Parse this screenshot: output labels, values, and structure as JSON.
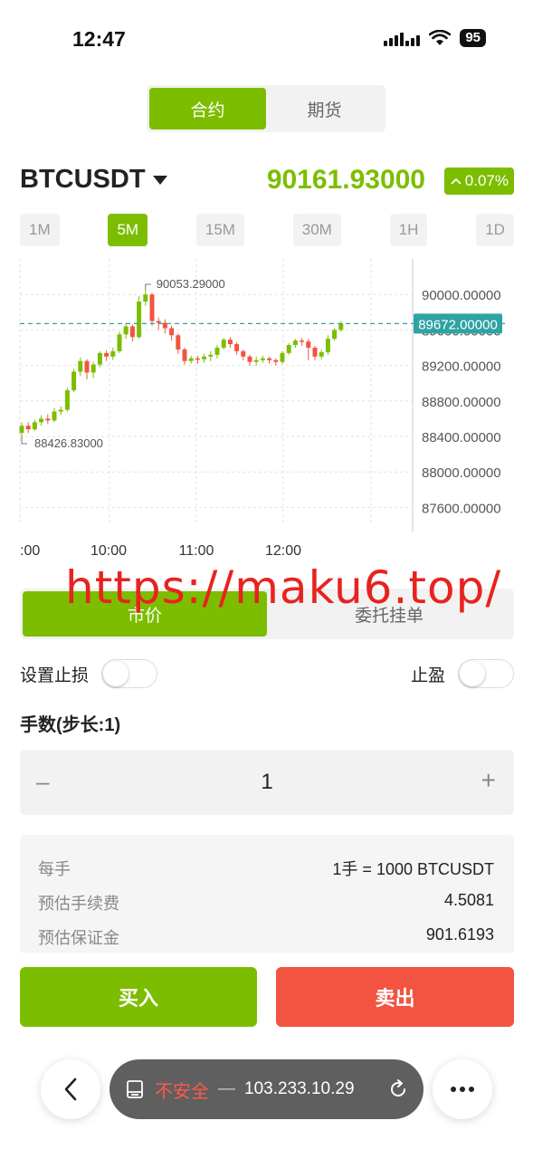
{
  "status_bar": {
    "time": "12:47",
    "battery": "95"
  },
  "top_tabs": [
    {
      "label": "合约",
      "active": true
    },
    {
      "label": "期货",
      "active": false
    }
  ],
  "symbol": {
    "name": "BTCUSDT",
    "price": "90161.93000",
    "change": "0.07%"
  },
  "intervals": [
    {
      "label": "1M",
      "active": false
    },
    {
      "label": "5M",
      "active": true
    },
    {
      "label": "15M",
      "active": false
    },
    {
      "label": "30M",
      "active": false
    },
    {
      "label": "1H",
      "active": false
    },
    {
      "label": "1D",
      "active": false
    }
  ],
  "chart_data": {
    "type": "candlestick",
    "y_ticks": [
      "90000.00000",
      "89600.00000",
      "89200.00000",
      "88800.00000",
      "88400.00000",
      "88000.00000",
      "87600.00000"
    ],
    "y_tick_values": [
      90000,
      89600,
      89200,
      88800,
      88400,
      88000,
      87600
    ],
    "ylim": [
      87400,
      90400
    ],
    "x_ticks": [
      ":00",
      "10:00",
      "11:00",
      "12:00"
    ],
    "current_price_label": "89672.00000",
    "current_price": 89672,
    "high_label": "90053.29000",
    "low_label": "88426.83000",
    "colors": {
      "up": "#7dbd00",
      "down": "#f25441",
      "current": "#2ea3a3"
    },
    "candles": [
      [
        88440,
        88520,
        88400,
        88560
      ],
      [
        88520,
        88480,
        88440,
        88560
      ],
      [
        88480,
        88560,
        88460,
        88590
      ],
      [
        88560,
        88600,
        88520,
        88640
      ],
      [
        88600,
        88580,
        88540,
        88650
      ],
      [
        88580,
        88680,
        88560,
        88720
      ],
      [
        88680,
        88700,
        88640,
        88740
      ],
      [
        88700,
        88920,
        88680,
        88950
      ],
      [
        88920,
        89130,
        88900,
        89160
      ],
      [
        89130,
        89250,
        89080,
        89290
      ],
      [
        89250,
        89120,
        89040,
        89270
      ],
      [
        89120,
        89210,
        89060,
        89240
      ],
      [
        89210,
        89340,
        89180,
        89360
      ],
      [
        89340,
        89300,
        89250,
        89370
      ],
      [
        89300,
        89360,
        89260,
        89400
      ],
      [
        89360,
        89550,
        89340,
        89580
      ],
      [
        89550,
        89640,
        89500,
        89680
      ],
      [
        89640,
        89520,
        89470,
        89660
      ],
      [
        89520,
        89920,
        89500,
        89980
      ],
      [
        89920,
        90000,
        89870,
        90053
      ],
      [
        90000,
        89700,
        89650,
        90020
      ],
      [
        89700,
        89680,
        89600,
        89740
      ],
      [
        89680,
        89620,
        89560,
        89720
      ],
      [
        89620,
        89540,
        89480,
        89650
      ],
      [
        89540,
        89380,
        89330,
        89560
      ],
      [
        89380,
        89250,
        89210,
        89400
      ],
      [
        89250,
        89280,
        89220,
        89310
      ],
      [
        89280,
        89270,
        89220,
        89310
      ],
      [
        89270,
        89300,
        89230,
        89330
      ],
      [
        89300,
        89320,
        89250,
        89360
      ],
      [
        89320,
        89400,
        89280,
        89430
      ],
      [
        89400,
        89490,
        89380,
        89510
      ],
      [
        89490,
        89440,
        89400,
        89520
      ],
      [
        89440,
        89360,
        89320,
        89460
      ],
      [
        89360,
        89300,
        89260,
        89380
      ],
      [
        89300,
        89240,
        89200,
        89320
      ],
      [
        89240,
        89260,
        89200,
        89300
      ],
      [
        89260,
        89280,
        89230,
        89310
      ],
      [
        89280,
        89260,
        89220,
        89300
      ],
      [
        89260,
        89240,
        89200,
        89280
      ],
      [
        89240,
        89340,
        89220,
        89360
      ],
      [
        89340,
        89430,
        89320,
        89450
      ],
      [
        89430,
        89480,
        89400,
        89500
      ],
      [
        89480,
        89470,
        89420,
        89510
      ],
      [
        89470,
        89400,
        89260,
        89500
      ],
      [
        89400,
        89300,
        89260,
        89420
      ],
      [
        89300,
        89350,
        89270,
        89380
      ],
      [
        89350,
        89500,
        89320,
        89540
      ],
      [
        89500,
        89600,
        89480,
        89620
      ],
      [
        89600,
        89672,
        89580,
        89700
      ]
    ]
  },
  "order_type": [
    {
      "label": "市价",
      "active": true
    },
    {
      "label": "委托挂单",
      "active": false
    }
  ],
  "stop_loss_label": "设置止损",
  "take_profit_label": "止盈",
  "quantity": {
    "label": "手数(步长:1)",
    "value": "1",
    "minus": "–",
    "plus": "+"
  },
  "info": [
    {
      "key": "每手",
      "value": "1手 = 1000 BTCUSDT"
    },
    {
      "key": "预估手续费",
      "value": "4.5081"
    },
    {
      "key": "预估保证金",
      "value": "901.6193"
    }
  ],
  "actions": {
    "buy": "买入",
    "sell": "卖出"
  },
  "browser": {
    "warning": "不安全",
    "separator": "—",
    "address": "103.233.10.29"
  },
  "watermark": "https://maku6.top/"
}
